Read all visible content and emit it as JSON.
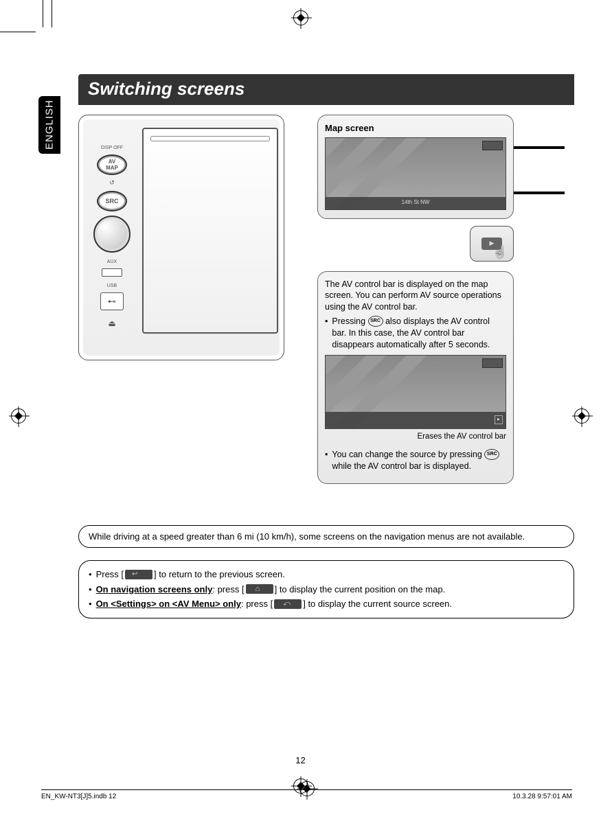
{
  "page": {
    "title": "Switching screens",
    "language_tab": "ENGLISH",
    "page_number": "12"
  },
  "device": {
    "disp_off": "DISP OFF",
    "av_map_line1": "AV",
    "av_map_line2": "MAP",
    "src": "SRC",
    "aux_label": "AUX",
    "usb_label": "USB"
  },
  "map_panel": {
    "title": "Map screen",
    "street": "14th St NW"
  },
  "touch": {
    "chip": "▶"
  },
  "av_panel": {
    "intro": "The AV control bar is displayed on the map screen. You can perform AV source operations using the AV control bar.",
    "bullet1_pre": "Pressing ",
    "bullet1_post": " also displays the AV control bar. In this case, the AV control bar disappears automatically after 5 seconds.",
    "caption": "Erases the AV control bar",
    "bullet2_pre": "You can change the source by pressing ",
    "bullet2_post": " while the AV control bar is displayed.",
    "src_label": "SRC"
  },
  "callouts": {
    "speed_warning": "While driving at a speed greater than 6 mi (10 km/h), some screens on the navigation menus are not available.",
    "b1_pre": "Press [",
    "b1_post": "] to return to the previous screen.",
    "b2_label": "On navigation screens only",
    "b2_mid": ": press [",
    "b2_post": "] to display the current position on the map.",
    "b3_label": "On <Settings> on <AV Menu> only",
    "b3_mid": ": press [",
    "b3_post": "] to display the current source screen."
  },
  "footer": {
    "file": "EN_KW-NT3[J]5.indb   12",
    "datetime": "10.3.28   9:57:01 AM"
  }
}
